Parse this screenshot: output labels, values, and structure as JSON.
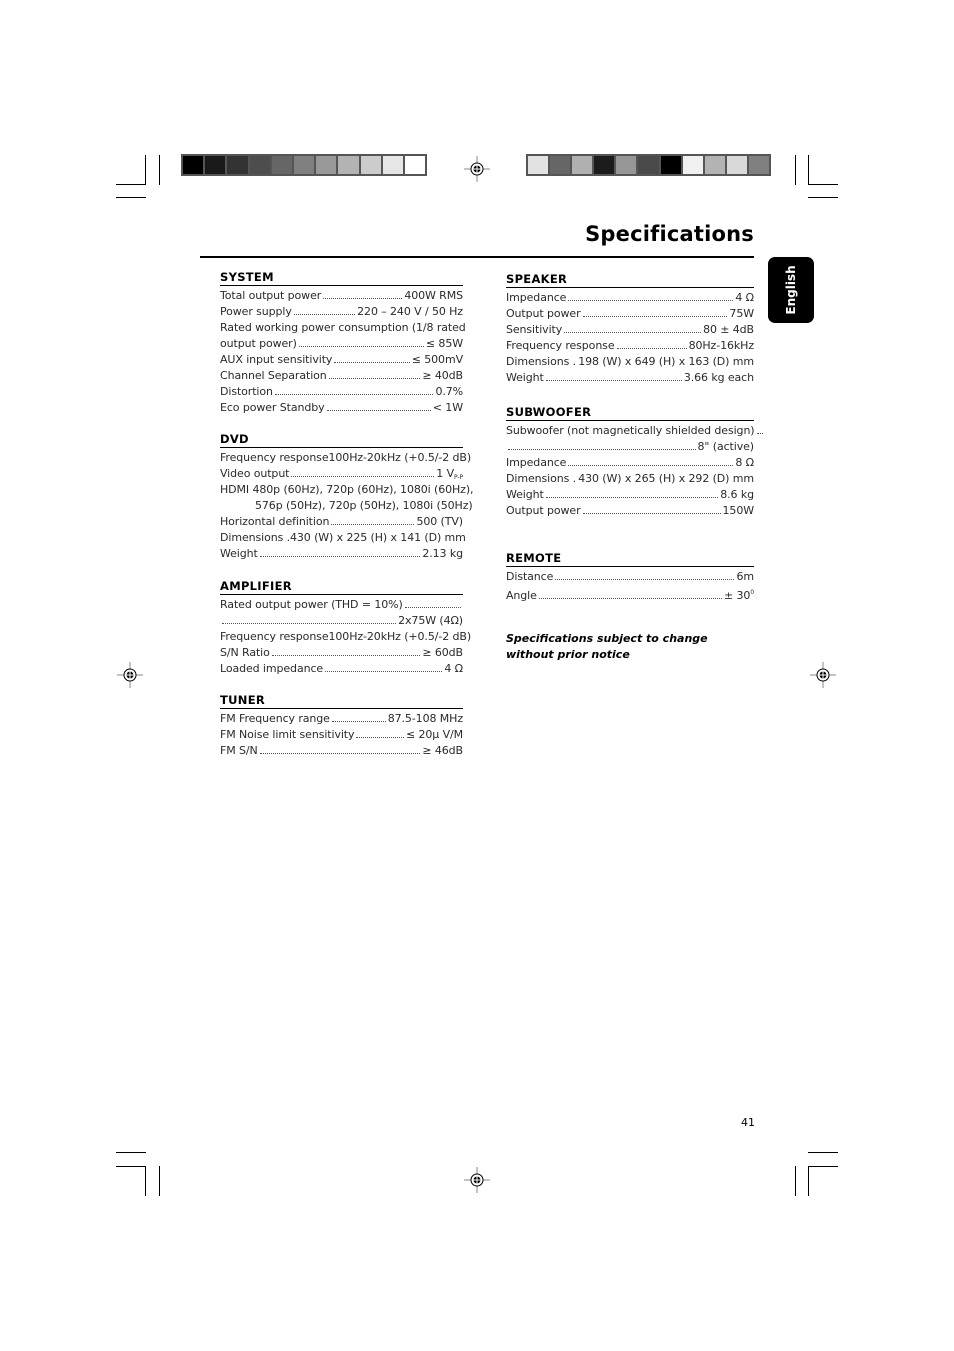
{
  "page": {
    "title": "Specifications",
    "language_tab": "English",
    "page_number": "41",
    "note": "Specifications subject to change without prior notice"
  },
  "color_bars": {
    "left": [
      "#000000",
      "#1a1a1a",
      "#333333",
      "#4d4d4d",
      "#666666",
      "#808080",
      "#999999",
      "#b3b3b3",
      "#cccccc",
      "#e6e6e6",
      "#ffffff"
    ],
    "right": [
      "#e2e2e2",
      "#666666",
      "#b0b0b0",
      "#1c1c1c",
      "#969696",
      "#4a4a4a",
      "#000000",
      "#f0f0f0",
      "#b3b3b3",
      "#d9d9d9",
      "#808080"
    ]
  },
  "sections": {
    "system": {
      "heading": "SYSTEM",
      "rows": [
        {
          "label": "Total output power",
          "value": "400W RMS"
        },
        {
          "label": "Power supply",
          "value": "220 – 240 V / 50 Hz"
        },
        {
          "label": "Rated working power consumption (1/8 rated",
          "value": ""
        },
        {
          "label": "output power)",
          "value": "≤ 85W"
        },
        {
          "label": "AUX input sensitivity",
          "value": "≤ 500mV"
        },
        {
          "label": "Channel Separation",
          "value": "≥ 40dB"
        },
        {
          "label": "Distortion",
          "value": "0.7%"
        },
        {
          "label": "Eco power Standby",
          "value": "< 1W"
        }
      ]
    },
    "dvd": {
      "heading": "DVD",
      "rows": [
        {
          "label": "Frequency response",
          "value": "100Hz-20kHz (+0.5/-2 dB)"
        },
        {
          "label": "Video output",
          "value": "1 V",
          "value_sub": "P-P"
        },
        {
          "label": "HDMI 480p (60Hz), 720p (60Hz), 1080i (60Hz),",
          "value": ""
        },
        {
          "label": "576p (50Hz), 720p (50Hz), 1080i (50Hz)",
          "value": ""
        },
        {
          "label": "Horizontal definition",
          "value": "500 (TV)"
        },
        {
          "label": "Dimensions",
          "value": "430 (W) x 225 (H) x 141 (D) mm"
        },
        {
          "label": "Weight",
          "value": "2.13 kg"
        }
      ]
    },
    "amplifier": {
      "heading": "AMPLIFIER",
      "rows": [
        {
          "label": "Rated output power (THD = 10%)",
          "value": ""
        },
        {
          "label": "",
          "value": "2x75W (4Ω)"
        },
        {
          "label": "Frequency response",
          "value": "100Hz-20kHz (+0.5/-2 dB)"
        },
        {
          "label": "S/N Ratio",
          "value": "≥ 60dB"
        },
        {
          "label": "Loaded impedance",
          "value": "4 Ω"
        }
      ]
    },
    "tuner": {
      "heading": "TUNER",
      "rows": [
        {
          "label": "FM Frequency range",
          "value": "87.5-108 MHz"
        },
        {
          "label": "FM Noise limit sensitivity",
          "value": "≤ 20µ V/M"
        },
        {
          "label": "FM S/N",
          "value": "≥ 46dB"
        }
      ]
    },
    "speaker": {
      "heading": "SPEAKER",
      "rows": [
        {
          "label": "Impedance",
          "value": "4 Ω"
        },
        {
          "label": "Output power",
          "value": "75W"
        },
        {
          "label": "Sensitivity",
          "value": "80 ± 4dB"
        },
        {
          "label": "Frequency response",
          "value": "80Hz-16kHz"
        },
        {
          "label": "Dimensions",
          "value": "198 (W) x 649 (H) x 163 (D) mm"
        },
        {
          "label": "Weight",
          "value": "3.66 kg each"
        }
      ]
    },
    "subwoofer": {
      "heading": "SUBWOOFER",
      "rows": [
        {
          "label": "Subwoofer (not magnetically shielded design)",
          "value": ""
        },
        {
          "label": "",
          "value": "8\" (active)"
        },
        {
          "label": "Impedance",
          "value": "8 Ω"
        },
        {
          "label": "Dimensions",
          "value": "430 (W) x 265 (H) x 292 (D) mm"
        },
        {
          "label": "Weight",
          "value": "8.6 kg"
        },
        {
          "label": "Output power",
          "value": "150W"
        }
      ]
    },
    "remote": {
      "heading": "REMOTE",
      "rows": [
        {
          "label": "Distance",
          "value": "6m"
        },
        {
          "label": "Angle",
          "value": "± 30",
          "value_sup": "0"
        }
      ]
    }
  }
}
